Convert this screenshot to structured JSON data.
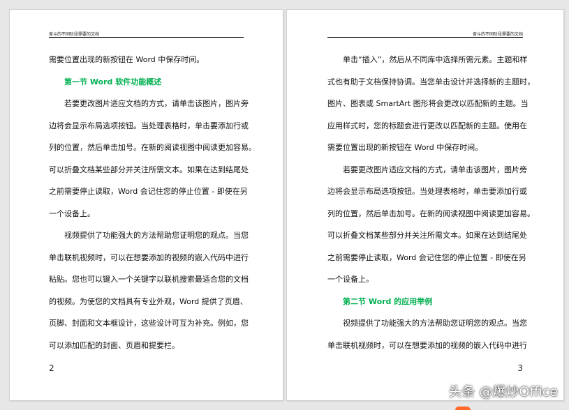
{
  "left_page": {
    "header": "奋斗的不同阶段需要的文档",
    "lines": [
      {
        "text": "需要位置出现的新按钮在 Word 中保存时间。",
        "type": "text"
      },
      {
        "text": "第一节 Word 软件功能概述",
        "type": "heading"
      },
      {
        "text": "若要更改图片适应文档的方式，请单击该图片，图片旁",
        "type": "indent"
      },
      {
        "text": "边将会显示布局选项按钮。当处理表格时，单击要添加行或",
        "type": "text"
      },
      {
        "text": "列的位置，然后单击加号。在新的阅读视图中阅读更加容易。",
        "type": "text"
      },
      {
        "text": "可以折叠文档某些部分并关注所需文本。如果在达到结尾处",
        "type": "text"
      },
      {
        "text": "之前需要停止读取，Word 会记住您的停止位置 - 即使在另",
        "type": "text"
      },
      {
        "text": "一个设备上。",
        "type": "text"
      },
      {
        "text": "视频提供了功能强大的方法帮助您证明您的观点。当您",
        "type": "indent"
      },
      {
        "text": "单击联机视频时，可以在想要添加的视频的嵌入代码中进行",
        "type": "text"
      },
      {
        "text": "粘贴。您也可以键入一个关键字以联机搜索最适合您的文档",
        "type": "text"
      },
      {
        "text": "的视频。为使您的文档具有专业外观，Word 提供了页眉、",
        "type": "text"
      },
      {
        "text": "页脚、封面和文本框设计，这些设计可互为补充。例如，您",
        "type": "text"
      },
      {
        "text": "可以添加匹配的封面、页眉和提要栏。",
        "type": "text"
      }
    ],
    "page_number": "2"
  },
  "right_page": {
    "header": "奋斗的不同阶段需要的文档",
    "lines": [
      {
        "text": "单击“插入”，然后从不同库中选择所需元素。主题和样",
        "type": "indent"
      },
      {
        "text": "式也有助于文档保持协调。当您单击设计并选择新的主题时，",
        "type": "text"
      },
      {
        "text": "图片、图表或 SmartArt 图形将会更改以匹配新的主题。当",
        "type": "text"
      },
      {
        "text": "应用样式时，您的标题会进行更改以匹配新的主题。使用在",
        "type": "text"
      },
      {
        "text": "需要位置出现的新按钮在 Word 中保存时间。",
        "type": "text"
      },
      {
        "text": "若要更改图片适应文档的方式，请单击该图片，图片旁",
        "type": "indent"
      },
      {
        "text": "边将会显示布局选项按钮。当处理表格时，单击要添加行或",
        "type": "text"
      },
      {
        "text": "列的位置，然后单击加号。在新的阅读视图中阅读更加容易。",
        "type": "text"
      },
      {
        "text": "可以折叠文档某些部分并关注所需文本。如果在达到结尾处",
        "type": "text"
      },
      {
        "text": "之前需要停止读取，Word 会记住您的停止位置 - 即使在另",
        "type": "text"
      },
      {
        "text": "一个设备上。",
        "type": "text"
      },
      {
        "text": "第二节 Word 的应用举例",
        "type": "heading"
      },
      {
        "text": "视频提供了功能强大的方法帮助您证明您的观点。当您",
        "type": "indent"
      },
      {
        "text": "单击联机视频时，可以在想要添加的视频的嵌入代码中进行",
        "type": "text"
      }
    ],
    "page_number": "3"
  },
  "watermark": "头条 @爆炒Office",
  "colors": {
    "heading": "#00b050",
    "canvas": "#e7e7e7",
    "page": "#ffffff"
  }
}
